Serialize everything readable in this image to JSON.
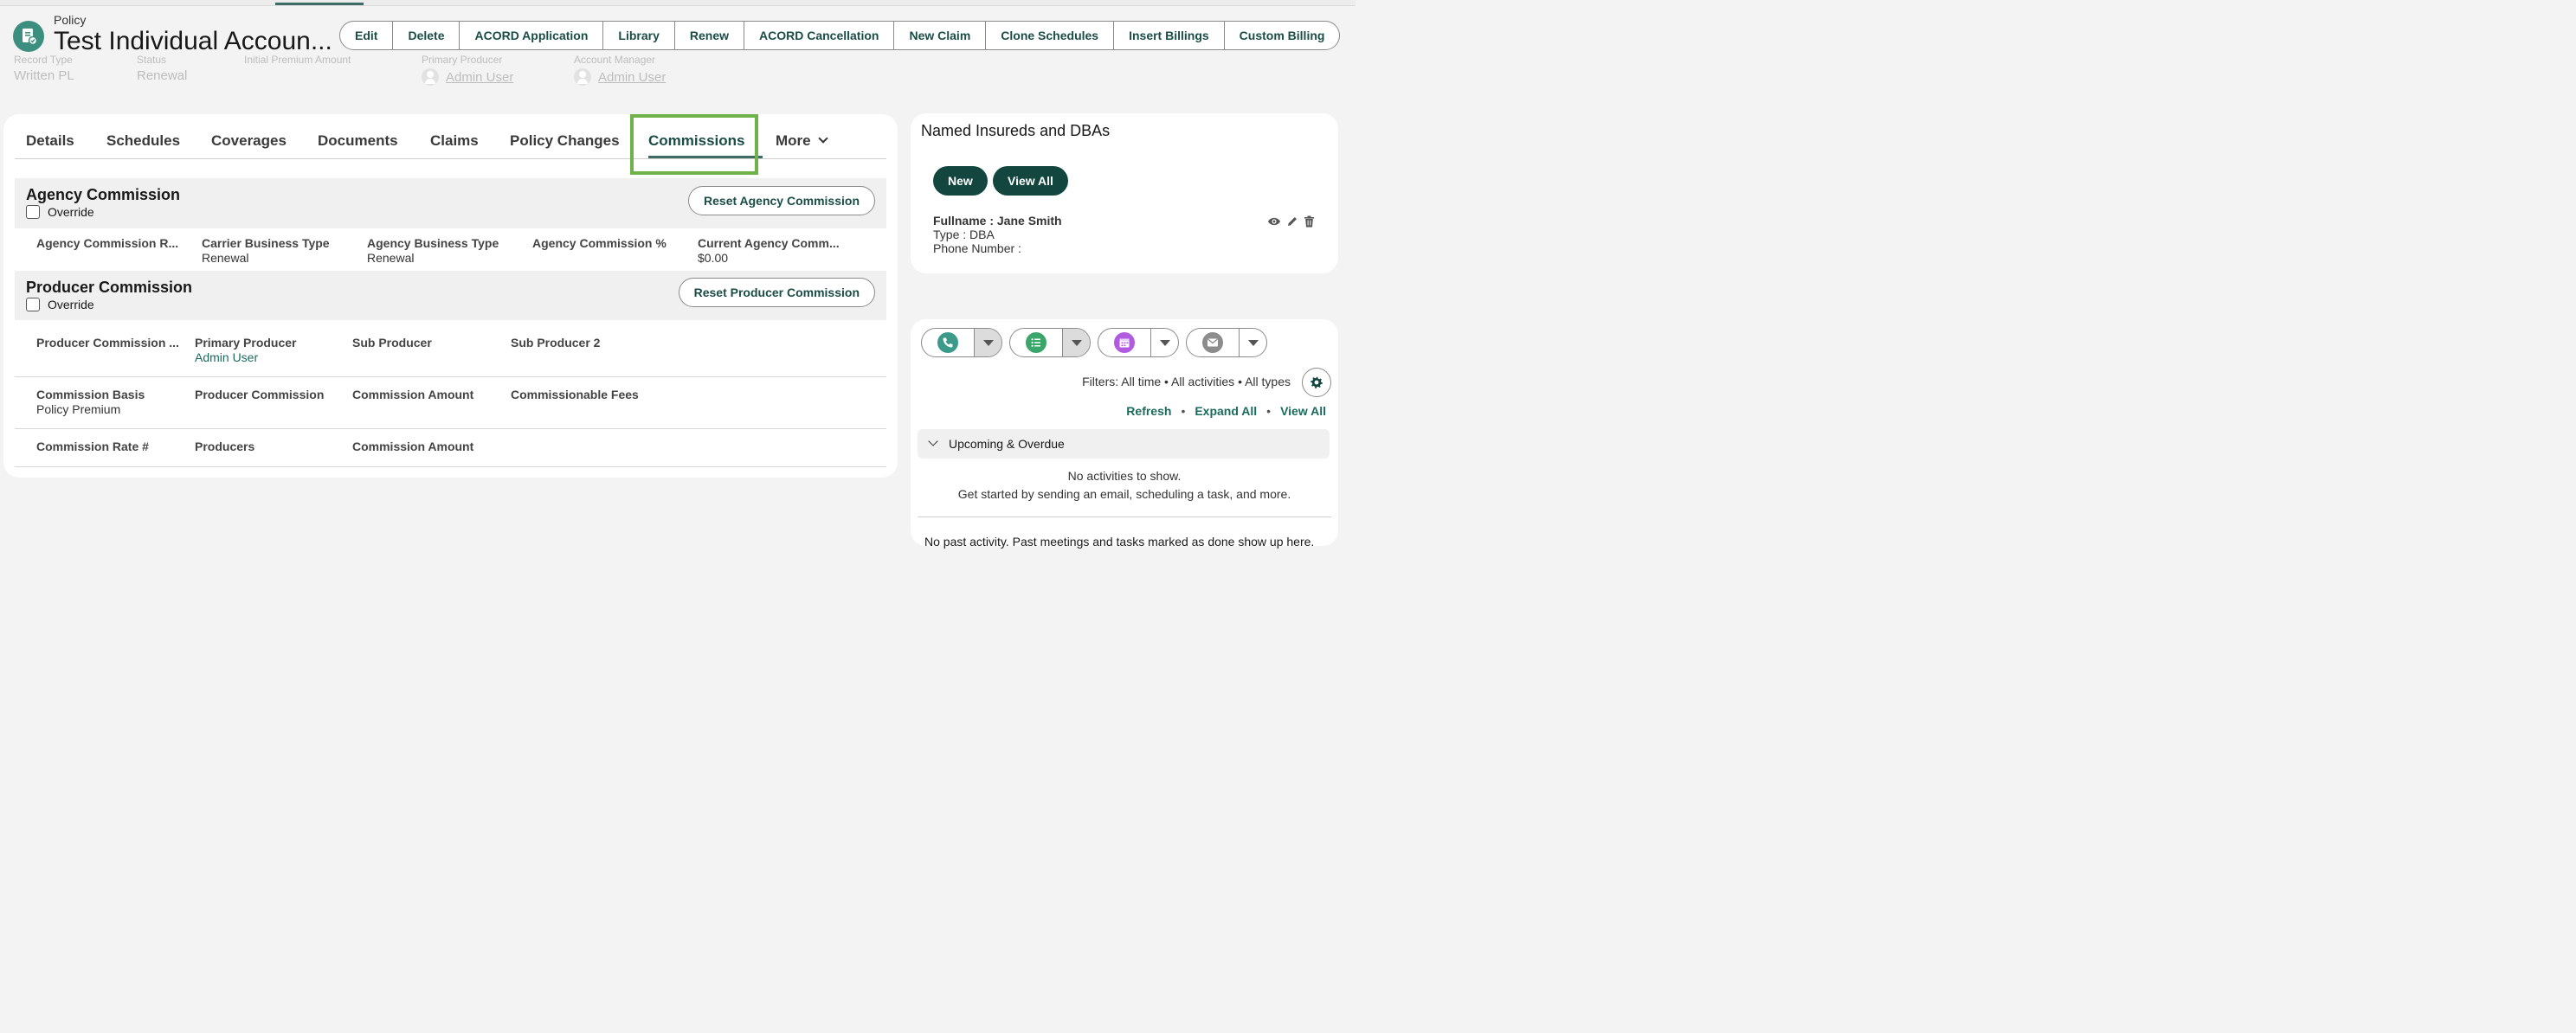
{
  "header": {
    "object_label": "Policy",
    "title": "Test Individual Accoun...",
    "actions": [
      "Edit",
      "Delete",
      "ACORD Application",
      "Library",
      "Renew",
      "ACORD Cancellation",
      "New Claim",
      "Clone Schedules",
      "Insert Billings",
      "Custom Billing"
    ]
  },
  "fields": {
    "record_type_label": "Record Type",
    "record_type": "Written PL",
    "status_label": "Status",
    "status": "Renewal",
    "initial_premium_label": "Initial Premium Amount",
    "primary_producer_label": "Primary Producer",
    "primary_producer": "Admin User",
    "account_manager_label": "Account Manager",
    "account_manager": "Admin User"
  },
  "tabs": {
    "items": [
      "Details",
      "Schedules",
      "Coverages",
      "Documents",
      "Claims",
      "Policy Changes",
      "Commissions"
    ],
    "more": "More",
    "active": "Commissions"
  },
  "agency": {
    "title": "Agency Commission",
    "override": "Override",
    "reset": "Reset Agency Commission",
    "cols": [
      {
        "h": "Agency Commission R...",
        "v": ""
      },
      {
        "h": "Carrier Business Type",
        "v": "Renewal"
      },
      {
        "h": "Agency Business Type",
        "v": "Renewal"
      },
      {
        "h": "Agency Commission %",
        "v": ""
      },
      {
        "h": "Current Agency Comm...",
        "v": "$0.00"
      }
    ]
  },
  "producer": {
    "title": "Producer Commission",
    "override": "Override",
    "reset": "Reset Producer Commission",
    "row1": [
      {
        "h": "Producer Commission ...",
        "v": ""
      },
      {
        "h": "Primary Producer",
        "v": "Admin User"
      },
      {
        "h": "Sub Producer",
        "v": ""
      },
      {
        "h": "Sub Producer 2",
        "v": ""
      }
    ],
    "row2": [
      {
        "h": "Commission Basis",
        "v": "Policy Premium"
      },
      {
        "h": "Producer Commission",
        "v": ""
      },
      {
        "h": "Commission Amount",
        "v": ""
      },
      {
        "h": "Commissionable Fees",
        "v": ""
      }
    ],
    "row3": [
      {
        "h": "Commission Rate #",
        "v": ""
      },
      {
        "h": "Producers",
        "v": ""
      },
      {
        "h": "Commission Amount",
        "v": ""
      }
    ]
  },
  "named_insureds": {
    "title": "Named Insureds and DBAs",
    "new": "New",
    "view_all": "View All",
    "entry": {
      "fullname": "Fullname : Jane Smith",
      "type": "Type : DBA",
      "phone": "Phone Number :"
    }
  },
  "activity": {
    "filters": "Filters: All time • All activities • All types",
    "refresh": "Refresh",
    "expand_all": "Expand All",
    "view_all": "View All",
    "upcoming": "Upcoming & Overdue",
    "no_activities": "No activities to show.",
    "get_started": "Get started by sending an email, scheduling a task, and more.",
    "past": "No past activity. Past meetings and tasks marked as done show up here."
  },
  "colors": {
    "brand_dark": "#12463f",
    "brand_text": "#1b4d47",
    "highlight": "#6fb24a",
    "call_icon": "#3c9a8b",
    "task_icon": "#3aa66a",
    "event_icon": "#b05be0",
    "email_icon": "#8c8c8c"
  }
}
